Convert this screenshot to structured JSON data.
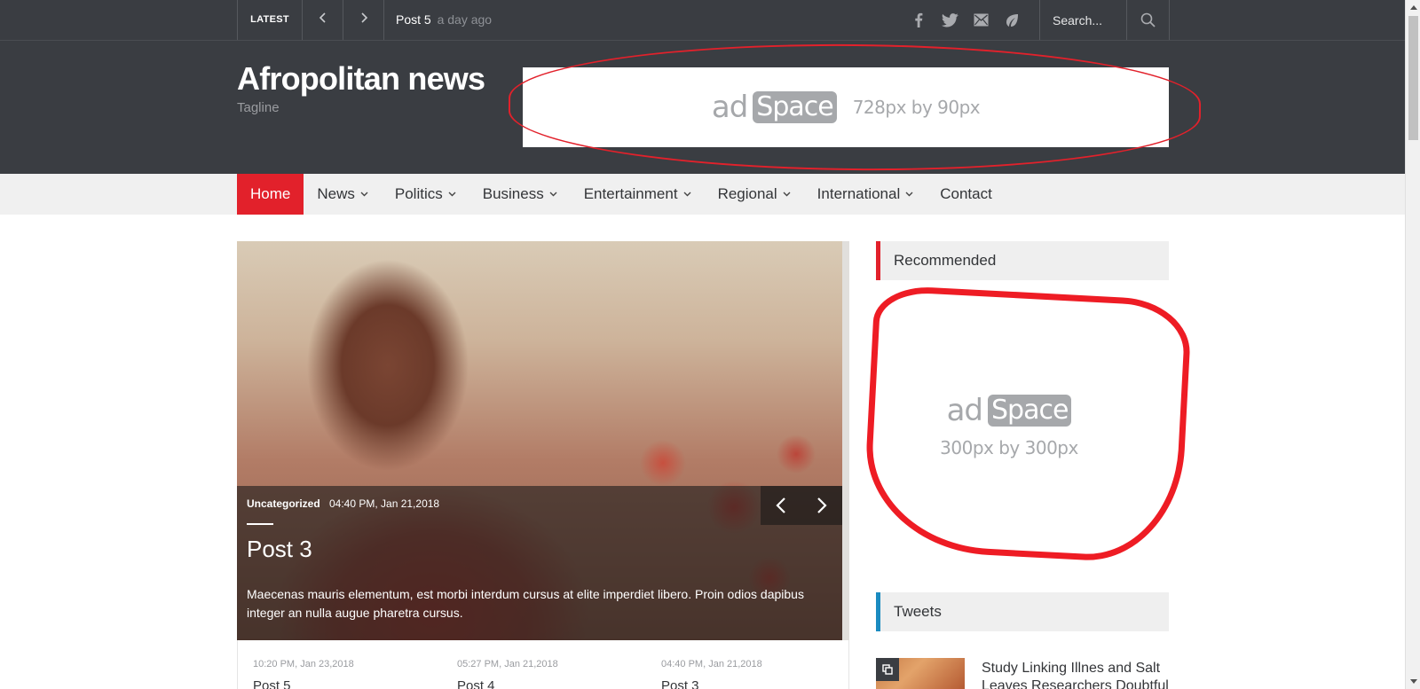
{
  "topbar": {
    "latest_label": "LATEST",
    "prev_icon": "chevron-left-icon",
    "next_icon": "chevron-right-icon",
    "ticker_title": "Post 5",
    "ticker_time": "a day ago",
    "socials": [
      "facebook-icon",
      "twitter-icon",
      "email-icon",
      "leaf-icon"
    ],
    "search_placeholder": "Search..."
  },
  "header": {
    "site_title": "Afropolitan news",
    "tagline": "Tagline",
    "banner_ad": {
      "ad": "ad",
      "space": "Space",
      "size": "728px by 90px"
    }
  },
  "nav": {
    "items": [
      {
        "label": "Home",
        "dropdown": false
      },
      {
        "label": "News",
        "dropdown": true
      },
      {
        "label": "Politics",
        "dropdown": true
      },
      {
        "label": "Business",
        "dropdown": true
      },
      {
        "label": "Entertainment",
        "dropdown": true
      },
      {
        "label": "Regional",
        "dropdown": true
      },
      {
        "label": "International",
        "dropdown": true
      },
      {
        "label": "Contact",
        "dropdown": false
      }
    ]
  },
  "slider": {
    "category": "Uncategorized",
    "date": "04:40 PM, Jan 21,2018",
    "title": "Post 3",
    "excerpt": "Maecenas mauris elementum, est morbi interdum cursus at elite imperdiet libero. Proin odios dapibus integer an nulla augue pharetra cursus."
  },
  "posts": [
    {
      "date": "10:20 PM, Jan 23,2018",
      "title": "Post 5"
    },
    {
      "date": "05:27 PM, Jan 21,2018",
      "title": "Post 4"
    },
    {
      "date": "04:40 PM, Jan 21,2018",
      "title": "Post 3"
    }
  ],
  "sidebar": {
    "recommended_title": "Recommended",
    "square_ad": {
      "ad": "ad",
      "space": "Space",
      "size": "300px by 300px"
    },
    "tweets_title": "Tweets",
    "tweet_text": "Study Linking Illnes and Salt Leaves Researchers Doubtful"
  },
  "colors": {
    "dark_bg": "#3a3d42",
    "accent_red": "#e2212b",
    "tweets_bar": "#1a8bc0",
    "annotation_red": "#ee1c24"
  }
}
